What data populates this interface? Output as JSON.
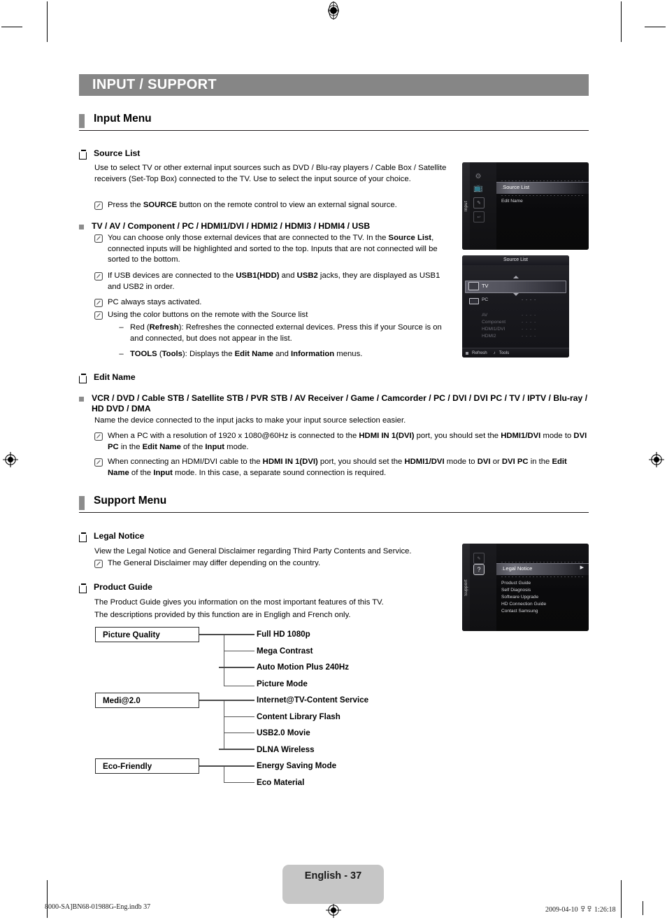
{
  "document": {
    "chapter_title": "INPUT / SUPPORT",
    "page_label": "English - 37",
    "footer_left": "8000-SA]BN68-01988G-Eng.indb   37",
    "footer_right": "2009-04-10   ㅱㅱ 1:26:18"
  },
  "input_menu": {
    "section_title": "Input Menu",
    "source_list": {
      "heading": "Source List",
      "paragraph": "Use to select TV or other external input sources such as DVD / Blu-ray players / Cable Box / Satellite receivers (Set-Top Box) connected to the TV. Use to select the input source of your choice.",
      "note_press": {
        "pre": "Press the ",
        "bold": "SOURCE",
        "post": " button on the remote control to view an external signal source."
      },
      "inputs_heading": "TV / AV / Component / PC / HDMI1/DVI / HDMI2 / HDMI3 / HDMI4 / USB",
      "notes": [
        "You can choose only those external devices that are connected to the TV. In the <b>Source List</b>, connected inputs will be highlighted and sorted to the top. Inputs that are not connected will be sorted to the bottom.",
        "If USB devices are connected to the <b>USB1(HDD)</b> and <b>USB2</b> jacks, they are displayed as USB1 and USB2 in order.",
        "PC always stays activated.",
        "Using the color buttons on the remote with the Source list"
      ],
      "dashes": [
        "Red (<b>Refresh</b>): Refreshes the connected external devices. Press this if your Source is on and connected, but does not appear in the list.",
        "<b>TOOLS</b> (<b>Tools</b>): Displays the <b>Edit Name</b> and <b>Information</b> menus."
      ]
    },
    "edit_name": {
      "heading": "Edit Name",
      "devices_heading": "VCR / DVD / Cable STB / Satellite STB / PVR STB / AV Receiver / Game / Camcorder / PC / DVI / DVI PC / TV / IPTV / Blu-ray / HD DVD / DMA",
      "paragraph": "Name the device connected to the input jacks to make your input source selection easier.",
      "notes": [
        "When a PC with a resolution of 1920 x 1080@60Hz is connected to the <b>HDMI IN 1(DVI)</b> port, you should set the <b>HDMI1/DVI</b> mode to <b>DVI PC</b> in the <b>Edit Name</b> of the <b>Input</b> mode.",
        "When connecting an HDMI/DVI cable to the <b>HDMI IN 1(DVI)</b> port, you should set the <b>HDMI1/DVI</b> mode to <b>DVI</b> or <b>DVI PC</b> in the <b>Edit Name</b> of the <b>Input</b> mode. In this case, a separate sound connection is required."
      ]
    }
  },
  "support_menu": {
    "section_title": "Support Menu",
    "legal_notice": {
      "heading": "Legal Notice",
      "paragraph": "View the Legal Notice and General Disclaimer regarding Third Party Contents and Service.",
      "note": "The General Disclaimer may differ depending on the country."
    },
    "product_guide": {
      "heading": "Product Guide",
      "paragraph_1": "The Product Guide gives you information on the most important features of this TV.",
      "paragraph_2": "The descriptions provided by this function are in Engligh and French only."
    }
  },
  "osd_input_menu": {
    "sidebar_label": "Input",
    "selected_item": "Source List",
    "items": [
      "Source List",
      "Edit Name"
    ],
    "glyphs": [
      "gear-icon",
      "source-list-icon",
      "edit-name-icon"
    ]
  },
  "osd_source_list": {
    "title": "Source List",
    "rows": [
      {
        "label": "TV",
        "value": "",
        "icon": "tv-icon",
        "selected": true,
        "dim": false
      },
      {
        "label": "PC",
        "value": "- - - -",
        "icon": "pc-icon",
        "selected": false,
        "dim": false
      },
      {
        "label": "AV",
        "value": "- - - -",
        "icon": "",
        "selected": false,
        "dim": true
      },
      {
        "label": "Component",
        "value": "- - - -",
        "icon": "",
        "selected": false,
        "dim": true
      },
      {
        "label": "HDMI1/DVI",
        "value": "- - - -",
        "icon": "",
        "selected": false,
        "dim": true
      },
      {
        "label": "HDMI2",
        "value": "- - - -",
        "icon": "",
        "selected": false,
        "dim": true
      }
    ],
    "footer": {
      "refresh": "Refresh",
      "tools": "Tools"
    }
  },
  "osd_support_menu": {
    "sidebar_label": "Support",
    "selected_item": "Legal Notice",
    "items": [
      "Legal Notice",
      "Product Guide",
      "Self Diagnosis",
      "Software Upgrade",
      "HD Connection Guide",
      "Contact Samsung"
    ]
  },
  "tree": {
    "groups": [
      {
        "name": "Picture Quality",
        "leaves": [
          "Full HD 1080p",
          "Mega Contrast",
          "Auto Motion Plus 240Hz",
          "Picture Mode"
        ]
      },
      {
        "name": "Medi@2.0",
        "leaves": [
          "Internet@TV-Content Service",
          "Content Library Flash",
          "USB2.0 Movie",
          "DLNA Wireless"
        ]
      },
      {
        "name": "Eco-Friendly",
        "leaves": [
          "Energy Saving Mode",
          "Eco Material"
        ]
      }
    ]
  },
  "colors": {
    "chapter_bar": "#868686",
    "section_marker": "#8c8c8c",
    "page_pill": "#c6c6c6"
  }
}
